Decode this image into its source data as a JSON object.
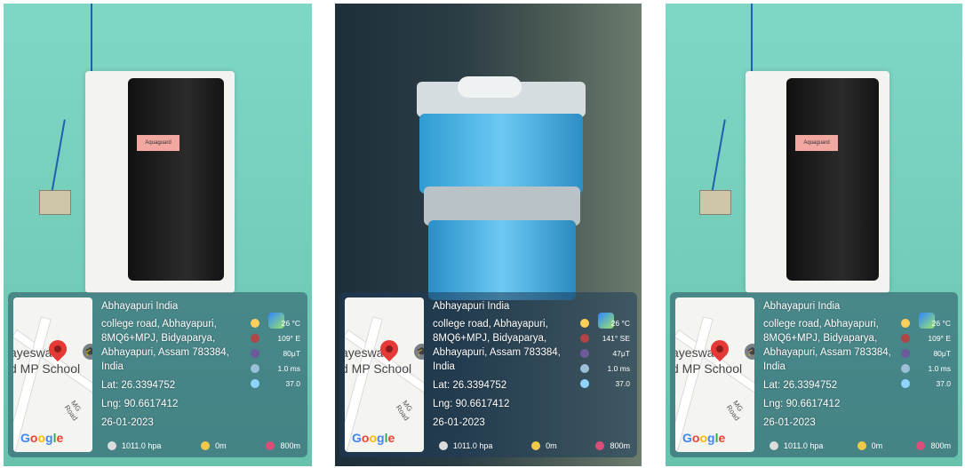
{
  "photos": [
    {
      "id": "p1",
      "kind": "wall purifier",
      "brand_label": "Aquaguard"
    },
    {
      "id": "p2",
      "kind": "tabletop purifier"
    },
    {
      "id": "p3",
      "kind": "wall purifier",
      "brand_label": "Aquaguard"
    }
  ],
  "overlay": {
    "place_title": "Abhayapuri India",
    "address_lines": [
      "college road, Abhayapuri,",
      "8MQ6+MPJ, Bidyaparya,",
      "Abhayapuri, Assam 783384,",
      "India"
    ],
    "lat": "Lat: 26.3394752",
    "lng": "Lng: 90.6617412",
    "date": "26-01-2023",
    "map_text_line1": "ayeswa",
    "map_text_line1b": "S",
    "map_text_line2": "d MP School",
    "road_label": "MG Road",
    "google_label": "Google",
    "pressure": "1011.0 hpa",
    "altitude": "0m",
    "accuracy": "800m"
  },
  "stats_variants": {
    "p1": {
      "temp": "26 °C",
      "wind_dir": "109° E",
      "magnetic": "80μT",
      "speed": "1.0 ms",
      "humidity": "37.0"
    },
    "p2": {
      "temp": "26 °C",
      "wind_dir": "141° SE",
      "magnetic": "47μT",
      "speed": "1.0 ms",
      "humidity": "37.0"
    },
    "p3": {
      "temp": "26 °C",
      "wind_dir": "109° E",
      "magnetic": "80μT",
      "speed": "1.0 ms",
      "humidity": "37.0"
    }
  },
  "colors": {
    "google_blue": "#4285F4",
    "google_red": "#EA4335",
    "google_yellow": "#FBBC05",
    "google_green": "#34A853",
    "pin_red": "#e53935"
  }
}
